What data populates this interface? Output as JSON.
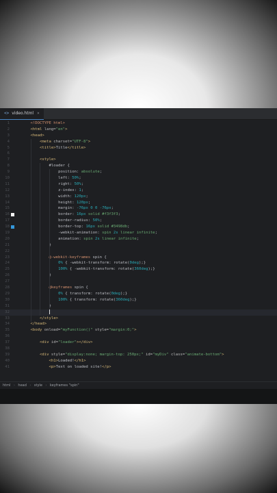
{
  "tab": {
    "icon": "html-file-icon",
    "label": "video.html",
    "close": "×"
  },
  "lines": [
    {
      "n": "1",
      "indent": 2,
      "tokens": [
        [
          "dt",
          "<!DOCTYPE html>"
        ]
      ]
    },
    {
      "n": "2",
      "indent": 2,
      "tokens": [
        [
          "tag",
          "<html "
        ],
        [
          "attr",
          "lang="
        ],
        [
          "str",
          "\"en\""
        ],
        [
          "tag",
          ">"
        ]
      ]
    },
    {
      "n": "3",
      "indent": 2,
      "tokens": [
        [
          "tag",
          "<head>"
        ]
      ]
    },
    {
      "n": "4",
      "indent": 4,
      "tokens": [
        [
          "tag",
          "<meta "
        ],
        [
          "attr",
          "charset="
        ],
        [
          "str",
          "\"UTF-8\""
        ],
        [
          "tag",
          ">"
        ]
      ]
    },
    {
      "n": "5",
      "indent": 4,
      "tokens": [
        [
          "tag",
          "<title>"
        ],
        [
          "sel",
          "Title"
        ],
        [
          "tag",
          "</title>"
        ]
      ]
    },
    {
      "n": "6",
      "indent": 0,
      "tokens": []
    },
    {
      "n": "7",
      "indent": 4,
      "tokens": [
        [
          "tag",
          "<style>"
        ]
      ]
    },
    {
      "n": "8",
      "indent": 6,
      "tokens": [
        [
          "sel",
          "#loader {"
        ]
      ]
    },
    {
      "n": "9",
      "indent": 8,
      "tokens": [
        [
          "prop",
          "position: "
        ],
        [
          "val",
          "absolute"
        ],
        [
          "prop",
          ";"
        ]
      ]
    },
    {
      "n": "10",
      "indent": 8,
      "tokens": [
        [
          "prop",
          "left: "
        ],
        [
          "num",
          "50%"
        ],
        [
          "prop",
          ";"
        ]
      ]
    },
    {
      "n": "11",
      "indent": 8,
      "tokens": [
        [
          "prop",
          "right: "
        ],
        [
          "num",
          "50%"
        ],
        [
          "prop",
          ";"
        ]
      ]
    },
    {
      "n": "12",
      "indent": 8,
      "tokens": [
        [
          "prop",
          "z-index: "
        ],
        [
          "num",
          "1"
        ],
        [
          "prop",
          ";"
        ]
      ]
    },
    {
      "n": "13",
      "indent": 8,
      "tokens": [
        [
          "prop",
          "width: "
        ],
        [
          "num",
          "120px"
        ],
        [
          "prop",
          ";"
        ]
      ]
    },
    {
      "n": "14",
      "indent": 8,
      "tokens": [
        [
          "prop",
          "height: "
        ],
        [
          "num",
          "120px"
        ],
        [
          "prop",
          ";"
        ]
      ]
    },
    {
      "n": "15",
      "indent": 8,
      "tokens": [
        [
          "prop",
          "margin: "
        ],
        [
          "num",
          "-76px 0 0 -76px"
        ],
        [
          "prop",
          ";"
        ]
      ]
    },
    {
      "n": "16",
      "indent": 8,
      "mark": "#f3f3f3",
      "tokens": [
        [
          "prop",
          "border: "
        ],
        [
          "num",
          "16px "
        ],
        [
          "val",
          "solid "
        ],
        [
          "val",
          "#f3f3f3"
        ],
        [
          "prop",
          ";"
        ]
      ]
    },
    {
      "n": "17",
      "indent": 8,
      "tokens": [
        [
          "prop",
          "border-radius: "
        ],
        [
          "num",
          "50%"
        ],
        [
          "prop",
          ";"
        ]
      ]
    },
    {
      "n": "18",
      "indent": 8,
      "mark": "#3498db",
      "tokens": [
        [
          "prop",
          "border-top: "
        ],
        [
          "num",
          "16px "
        ],
        [
          "val",
          "solid "
        ],
        [
          "val",
          "#3498db"
        ],
        [
          "prop",
          ";"
        ]
      ]
    },
    {
      "n": "19",
      "indent": 8,
      "tokens": [
        [
          "prop",
          "-webkit-animation: "
        ],
        [
          "val",
          "spin "
        ],
        [
          "num",
          "2s "
        ],
        [
          "val",
          "linear infinite"
        ],
        [
          "prop",
          ";"
        ]
      ]
    },
    {
      "n": "20",
      "indent": 8,
      "tokens": [
        [
          "prop",
          "animation: "
        ],
        [
          "val",
          "spin "
        ],
        [
          "num",
          "2s "
        ],
        [
          "val",
          "linear infinite"
        ],
        [
          "prop",
          ";"
        ]
      ]
    },
    {
      "n": "21",
      "indent": 6,
      "tokens": [
        [
          "sel",
          "}"
        ]
      ]
    },
    {
      "n": "22",
      "indent": 0,
      "tokens": []
    },
    {
      "n": "23",
      "indent": 6,
      "tokens": [
        [
          "kw",
          "@-webkit-keyframes "
        ],
        [
          "sel",
          "spin {"
        ]
      ]
    },
    {
      "n": "24",
      "indent": 8,
      "tokens": [
        [
          "num",
          "0% "
        ],
        [
          "sel",
          "{ "
        ],
        [
          "prop",
          "-webkit-transform"
        ],
        [
          "prop",
          ": rotate("
        ],
        [
          "num",
          "0deg"
        ],
        [
          "prop",
          ");}"
        ]
      ]
    },
    {
      "n": "25",
      "indent": 8,
      "tokens": [
        [
          "num",
          "100% "
        ],
        [
          "sel",
          "{ "
        ],
        [
          "prop",
          "-webkit-transform"
        ],
        [
          "prop",
          ": rotate("
        ],
        [
          "num",
          "360deg"
        ],
        [
          "prop",
          ");}"
        ]
      ]
    },
    {
      "n": "26",
      "indent": 6,
      "tokens": [
        [
          "sel",
          "}"
        ]
      ]
    },
    {
      "n": "27",
      "indent": 0,
      "tokens": []
    },
    {
      "n": "28",
      "indent": 6,
      "tokens": [
        [
          "kw",
          "@keyframes "
        ],
        [
          "sel",
          "spin {"
        ]
      ]
    },
    {
      "n": "29",
      "indent": 8,
      "tokens": [
        [
          "num",
          "0% "
        ],
        [
          "sel",
          "{ "
        ],
        [
          "prop",
          "transform: rotate("
        ],
        [
          "num",
          "0deg"
        ],
        [
          "prop",
          ");}"
        ]
      ]
    },
    {
      "n": "30",
      "indent": 8,
      "tokens": [
        [
          "num",
          "100% "
        ],
        [
          "sel",
          "{ "
        ],
        [
          "prop",
          "transform: rotate("
        ],
        [
          "num",
          "360deg"
        ],
        [
          "prop",
          ");}"
        ]
      ]
    },
    {
      "n": "31",
      "indent": 6,
      "tokens": [
        [
          "sel",
          "}"
        ]
      ]
    },
    {
      "n": "32",
      "indent": 6,
      "current": true,
      "tokens": []
    },
    {
      "n": "33",
      "indent": 4,
      "tokens": [
        [
          "tag",
          "</style>"
        ]
      ]
    },
    {
      "n": "34",
      "indent": 2,
      "tokens": [
        [
          "tag",
          "</head>"
        ]
      ]
    },
    {
      "n": "35",
      "indent": 2,
      "tokens": [
        [
          "tag",
          "<body "
        ],
        [
          "attr",
          "onload="
        ],
        [
          "str",
          "\"myFunction()\" "
        ],
        [
          "attr",
          "style="
        ],
        [
          "str",
          "\"margin:0;\""
        ],
        [
          "tag",
          ">"
        ]
      ]
    },
    {
      "n": "36",
      "indent": 0,
      "tokens": []
    },
    {
      "n": "37",
      "indent": 4,
      "tokens": [
        [
          "tag",
          "<div "
        ],
        [
          "attr",
          "id="
        ],
        [
          "str",
          "\"loader\""
        ],
        [
          "tag",
          "></div>"
        ]
      ]
    },
    {
      "n": "38",
      "indent": 0,
      "tokens": []
    },
    {
      "n": "39",
      "indent": 4,
      "tokens": [
        [
          "tag",
          "<div "
        ],
        [
          "attr",
          "style="
        ],
        [
          "str",
          "\"display:none; margin-top: 250px;\" "
        ],
        [
          "attr",
          "id="
        ],
        [
          "str",
          "\"myDiv\" "
        ],
        [
          "attr",
          "class="
        ],
        [
          "str",
          "\"animate-bottom\""
        ],
        [
          "tag",
          ">"
        ]
      ]
    },
    {
      "n": "40",
      "indent": 6,
      "tokens": [
        [
          "tag",
          "<h1>"
        ],
        [
          "sel",
          "Loaded!"
        ],
        [
          "tag",
          "</h1>"
        ]
      ]
    },
    {
      "n": "41",
      "indent": 6,
      "tokens": [
        [
          "tag",
          "<p>"
        ],
        [
          "sel",
          "Text on loaded site!"
        ],
        [
          "tag",
          "</p>"
        ]
      ]
    }
  ],
  "breadcrumb": [
    "html",
    "head",
    "style",
    "keyframes \"spin\""
  ]
}
